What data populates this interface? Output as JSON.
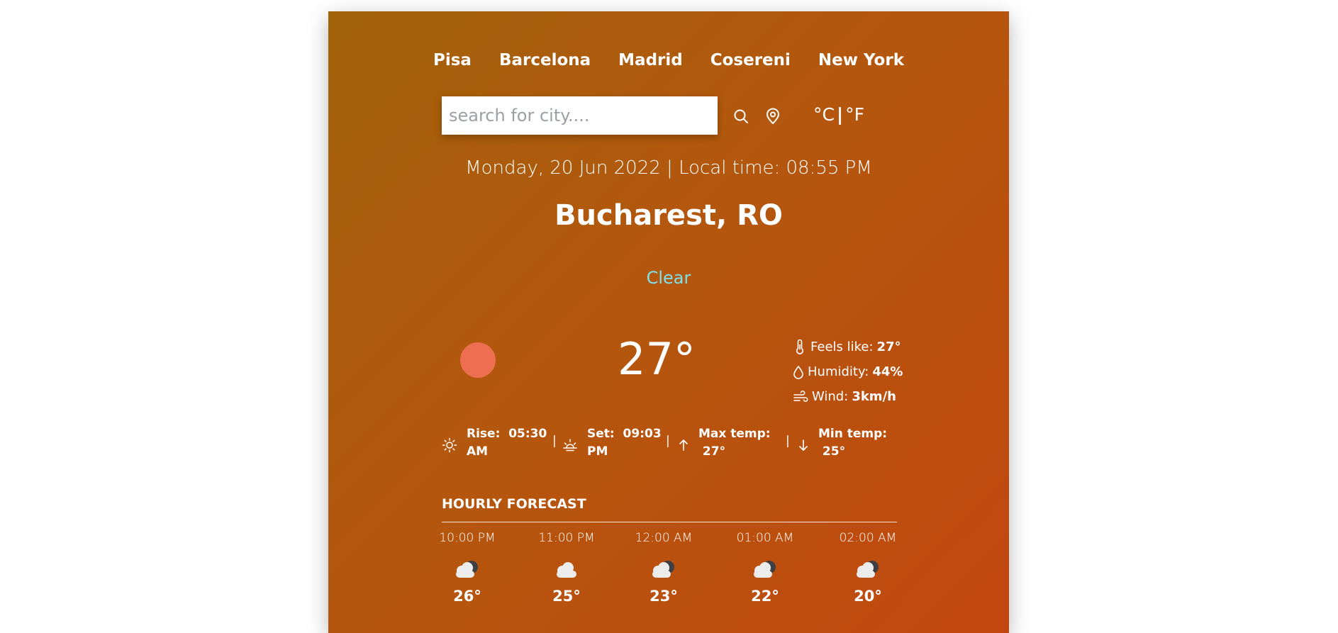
{
  "nav": {
    "cities": [
      "Pisa",
      "Barcelona",
      "Madrid",
      "Cosereni",
      "New York"
    ]
  },
  "search": {
    "placeholder": "search for city....",
    "value": ""
  },
  "units": {
    "celsius": "°C",
    "separator": "|",
    "fahrenheit": "°F"
  },
  "datetime": "Monday, 20 Jun 2022 | Local time: 08:55 PM",
  "location": "Bucharest, RO",
  "condition": "Clear",
  "temperature": "27°",
  "details": {
    "feels_like_label": "Feels like:",
    "feels_like_value": "27°",
    "humidity_label": "Humidity:",
    "humidity_value": "44%",
    "wind_label": "Wind:",
    "wind_value": "3km/h"
  },
  "sun": {
    "rise_label": "Rise:",
    "rise_value": "05:30",
    "rise_suffix": "AM",
    "set_label": "Set:",
    "set_value": "09:03",
    "set_suffix": "PM",
    "max_label": "Max temp:",
    "max_value": "27°",
    "min_label": "Min temp:",
    "min_value": "25°",
    "separator": "|"
  },
  "hourly": {
    "title": "HOURLY FORECAST",
    "items": [
      {
        "time": "10:00 PM",
        "temp": "26°",
        "icon": "partly-cloudy-night-icon"
      },
      {
        "time": "11:00 PM",
        "temp": "25°",
        "icon": "cloud-icon"
      },
      {
        "time": "12:00 AM",
        "temp": "23°",
        "icon": "partly-cloudy-night-icon"
      },
      {
        "time": "01:00 AM",
        "temp": "22°",
        "icon": "partly-cloudy-night-icon"
      },
      {
        "time": "02:00 AM",
        "temp": "20°",
        "icon": "partly-cloudy-night-icon"
      }
    ]
  },
  "colors": {
    "condition": "#7ee0e8",
    "sun_ball": "#ee6e52",
    "gradient_start": "#a2620a",
    "gradient_end": "#c2470f"
  }
}
